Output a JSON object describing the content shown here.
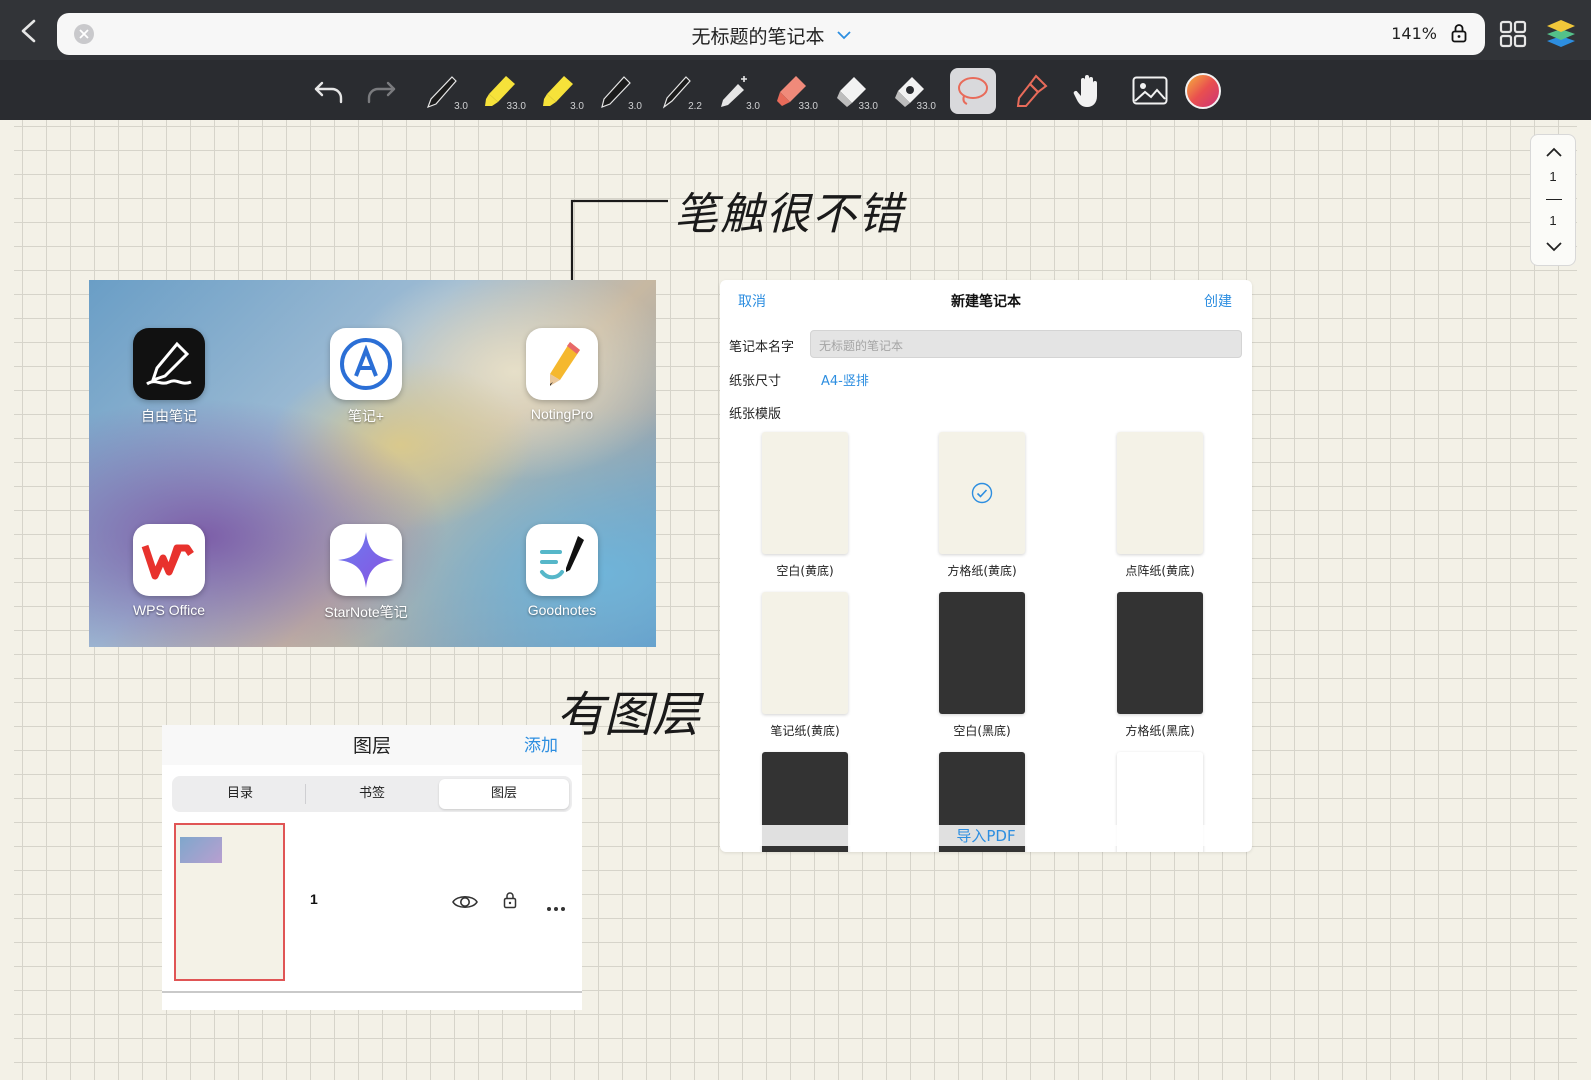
{
  "window": {
    "notebook_title": "无标题的笔记本",
    "zoom": "141%"
  },
  "toolbar": {
    "tools": [
      {
        "name": "pen",
        "size": "3.0"
      },
      {
        "name": "highlighter",
        "size": "33.0"
      },
      {
        "name": "highlighter-2",
        "size": "3.0"
      },
      {
        "name": "pen-2",
        "size": "3.0"
      },
      {
        "name": "brush-pen",
        "size": "2.2"
      },
      {
        "name": "magic-pen",
        "size": "3.0"
      },
      {
        "name": "erase-brush",
        "size": "33.0"
      },
      {
        "name": "eraser",
        "size": "33.0"
      },
      {
        "name": "area-eraser",
        "size": "33.0"
      }
    ],
    "active_tool": "lasso",
    "color": "#e94f4f"
  },
  "pager": {
    "current": "1",
    "total": "1"
  },
  "annotations": {
    "note_top": "笔触很不错",
    "note_bottom": "有图层"
  },
  "apps": [
    {
      "label": "自由笔记",
      "icon": "pen-scribble-icon"
    },
    {
      "label": "笔记+",
      "icon": "letter-a-icon"
    },
    {
      "label": "NotingPro",
      "icon": "pencil-icon"
    },
    {
      "label": "WPS Office",
      "icon": "wps-logo-icon"
    },
    {
      "label": "StarNote笔记",
      "icon": "star-sparkle-icon"
    },
    {
      "label": "Goodnotes",
      "icon": "goodnotes-logo-icon"
    }
  ],
  "dialog": {
    "cancel": "取消",
    "title": "新建笔记本",
    "create": "创建",
    "name_label": "笔记本名字",
    "name_placeholder": "无标题的笔记本",
    "size_label": "纸张尺寸",
    "size_value": "A4-竖排",
    "template_label": "纸张模版",
    "templates": [
      {
        "label": "空白(黄底)",
        "style": "yellow",
        "selected": false
      },
      {
        "label": "方格纸(黄底)",
        "style": "yellow",
        "selected": true
      },
      {
        "label": "点阵纸(黄底)",
        "style": "yellow",
        "selected": false
      },
      {
        "label": "笔记纸(黄底)",
        "style": "yellow",
        "selected": false
      },
      {
        "label": "空白(黑底)",
        "style": "dark",
        "selected": false
      },
      {
        "label": "方格纸(黑底)",
        "style": "dark",
        "selected": false
      },
      {
        "label": "",
        "style": "dark",
        "selected": false
      },
      {
        "label": "",
        "style": "dark",
        "selected": false
      },
      {
        "label": "",
        "style": "white",
        "selected": false
      }
    ],
    "import_pdf": "导入PDF"
  },
  "layers_panel": {
    "title": "图层",
    "add": "添加",
    "tabs": [
      "目录",
      "书签",
      "图层"
    ],
    "active_tab": "图层",
    "layer_number": "1"
  }
}
